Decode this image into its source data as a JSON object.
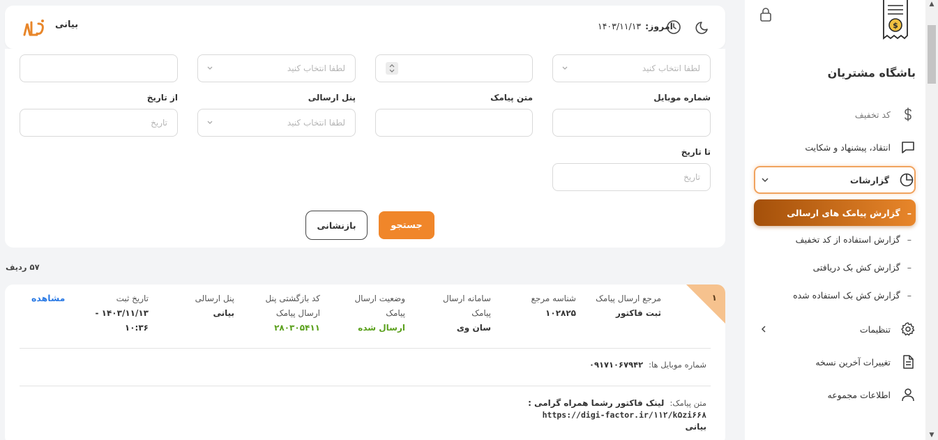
{
  "sidebar": {
    "title": "باشگاه مشتریان",
    "items": [
      {
        "label": "کد تخفیف",
        "icon": "dollar-icon"
      },
      {
        "label": "انتقاد، پیشنهاد و شکایت",
        "icon": "chat-icon"
      },
      {
        "label": "گزارشات",
        "icon": "pie-chart-icon"
      },
      {
        "label": "تنظیمات",
        "icon": "gear-icon"
      },
      {
        "label": "تغییرات آخرین نسخه",
        "icon": "document-icon"
      },
      {
        "label": "اطلاعات مجموعه",
        "icon": "user-icon"
      }
    ],
    "reports_sub": [
      "گزارش پیامک های ارسالی",
      "گزارش استفاده از کد تخفیف",
      "گزارش کش بک دریافتی",
      "گزارش کش بک استفاده شده"
    ],
    "active_color": "#e8862a"
  },
  "header": {
    "brand": "بیانی",
    "today_label": "امروز:",
    "today_date": "۱۴۰۳/۱۱/۱۳"
  },
  "filters": {
    "placeholder_select": "لطفا انتخاب کنید",
    "placeholder_date": "تاریخ",
    "mobile_label": "شماره موبایل",
    "sms_text_label": "متن پیامک",
    "panel_label": "پنل ارسالی",
    "from_date_label": "از تاریخ",
    "to_date_label": "تا تاریخ",
    "search_button": "جستجو",
    "reset_button": "بازنشانی"
  },
  "results": {
    "row_count": "۵۷ ردیف",
    "rows": [
      {
        "index": "۱",
        "ref_label": "مرجع ارسال پیامک",
        "ref_value": "ثبت فاکتور",
        "ref_id_label": "شناسه مرجع",
        "ref_id_value": "۱۰۲۸۲۵",
        "system_label_1": "سامانه ارسال",
        "system_label_2": "پیامک",
        "system_value": "سان وی",
        "status_label_1": "وضعیت ارسال",
        "status_label_2": "پیامک",
        "status_value": "ارسال شده",
        "return_label_1": "کد بازگشتی پنل",
        "return_label_2": "ارسال پیامک",
        "return_value": "۲۸۰۳۰۵۴۱۱",
        "panel_label": "پنل ارسالی",
        "panel_value": "بیانی",
        "date_label": "تاریخ ثبت",
        "date_value_1": "۱۴۰۳/۱۱/۱۳ -",
        "date_value_2": "۱۰:۳۶",
        "view_link": "مشاهده",
        "mobiles_label": "شماره موبایل ها:",
        "mobiles_value": "۰۹۱۷۱۰۶۷۹۴۲",
        "sms_label": "متن پیامک:",
        "sms_value_1": "لینک فاکتور رشما همراه گرامی :",
        "sms_url": "https://digi-factor.ir/۱۱۲/k۵zi۶۶۸",
        "sms_value_2": "بیانی"
      }
    ]
  }
}
